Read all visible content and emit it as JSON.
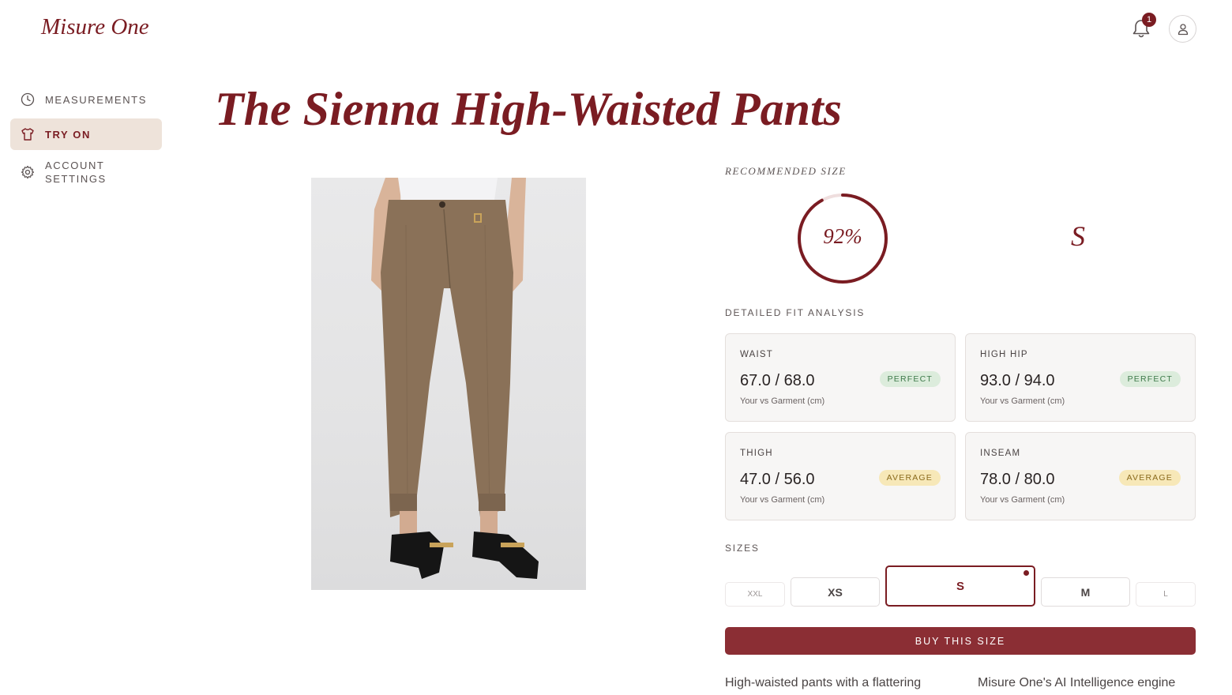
{
  "header": {
    "brand": "Misure One",
    "notification_count": "1"
  },
  "sidebar": {
    "items": [
      {
        "label": "MEASUREMENTS",
        "icon": "clock-icon"
      },
      {
        "label": "TRY ON",
        "icon": "shirt-icon",
        "active": true
      },
      {
        "label": "ACCOUNT SETTINGS",
        "icon": "gear-icon"
      }
    ]
  },
  "product": {
    "title": "The Sienna High-Waisted Pants",
    "image_alt": "Model wearing brown check high-waisted cropped pants with black loafers"
  },
  "recommendation": {
    "label": "RECOMMENDED SIZE",
    "confidence_text": "92%",
    "confidence": 0.92,
    "size": "S"
  },
  "fit_analysis": {
    "label": "DETAILED FIT ANALYSIS",
    "cards": [
      {
        "name": "WAIST",
        "value": "67.0 / 68.0",
        "sub": "Your vs Garment (cm)",
        "tag": "PERFECT"
      },
      {
        "name": "HIGH HIP",
        "value": "93.0 / 94.0",
        "sub": "Your vs Garment (cm)",
        "tag": "PERFECT"
      },
      {
        "name": "THIGH",
        "value": "47.0 / 56.0",
        "sub": "Your vs Garment (cm)",
        "tag": "AVERAGE"
      },
      {
        "name": "INSEAM",
        "value": "78.0 / 80.0",
        "sub": "Your vs Garment (cm)",
        "tag": "AVERAGE"
      }
    ]
  },
  "sizes": {
    "label": "SIZES",
    "options": [
      "XXL",
      "XS",
      "S",
      "M",
      "L"
    ],
    "selected": "S"
  },
  "buy_label": "BUY THIS SIZE",
  "description": {
    "left": "High-waisted pants with a flattering",
    "right": "Misure One's AI Intelligence engine"
  },
  "colors": {
    "accent": "#7a1c22",
    "button": "#8b2e34",
    "active_nav_bg": "#eee3da",
    "perfect_bg": "#dcecdc",
    "average_bg": "#f7e8b8"
  }
}
